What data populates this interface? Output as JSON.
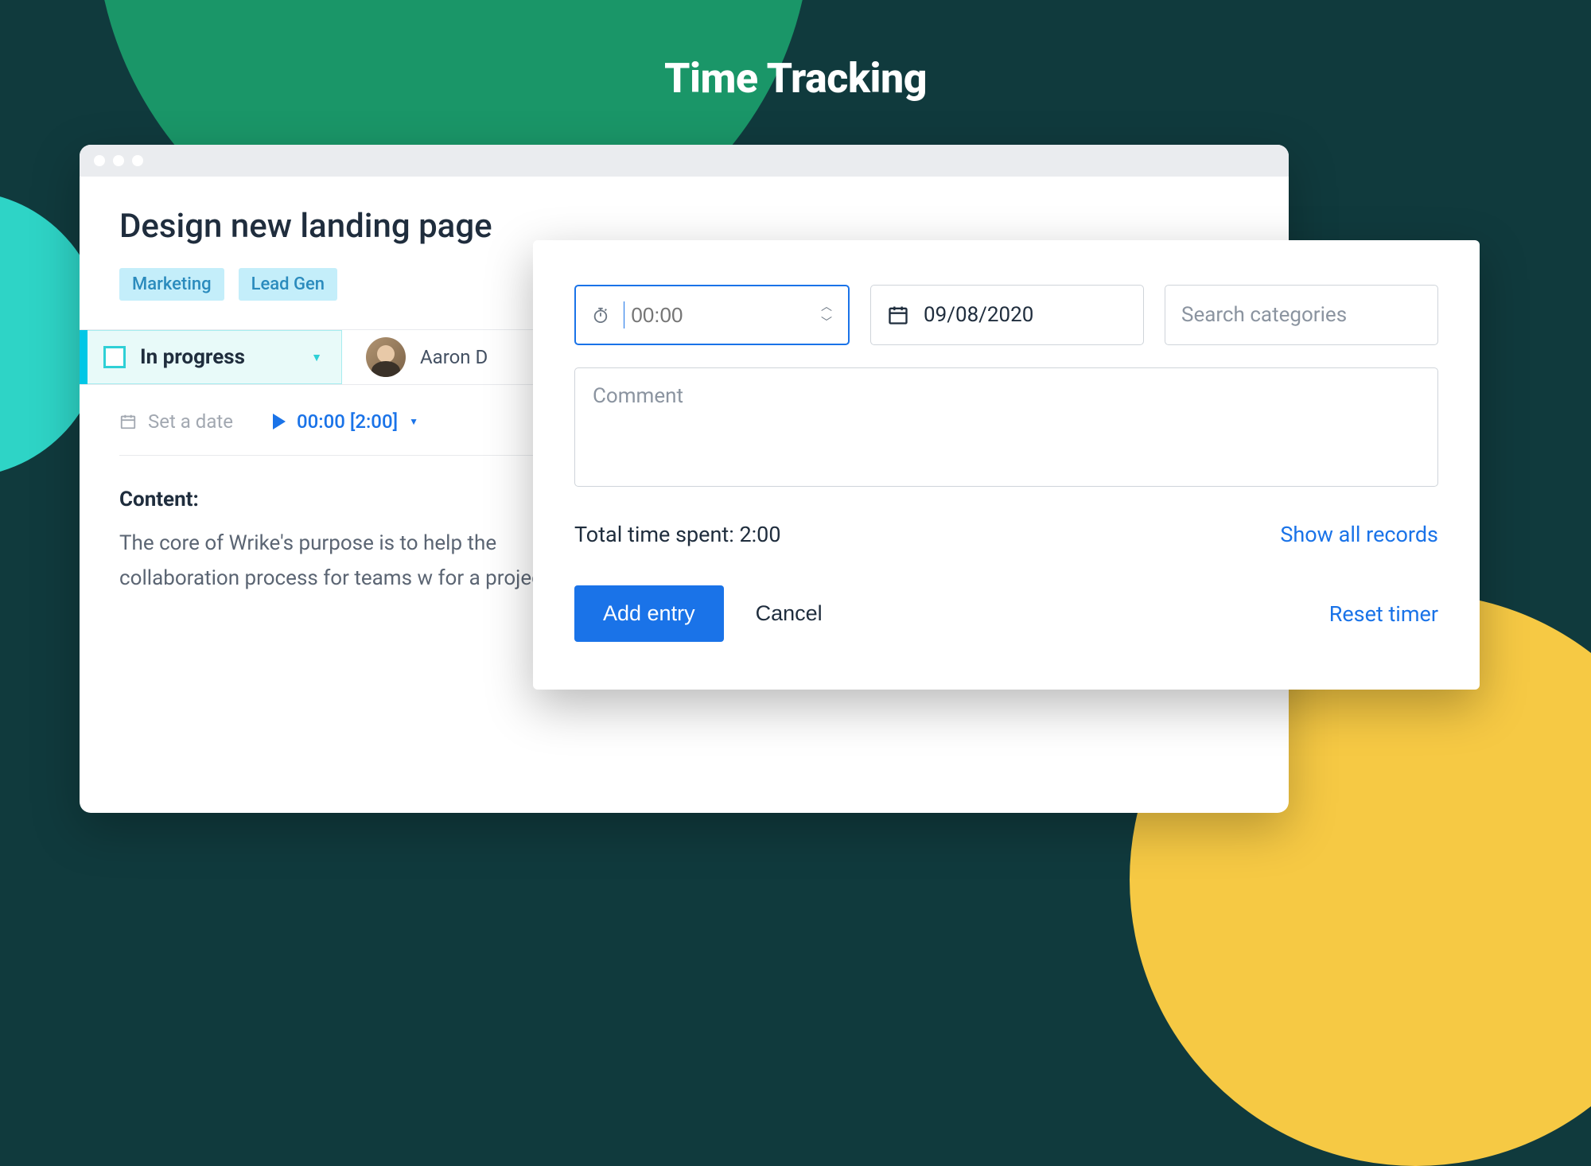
{
  "page_title": "Time Tracking",
  "task": {
    "title": "Design new landing page",
    "tags": [
      "Marketing",
      "Lead Gen"
    ],
    "status": "In progress",
    "assignee_name": "Aaron D",
    "date_placeholder": "Set a date",
    "timer_value": "00:00 [2:00]",
    "content_heading": "Content:",
    "content_body": "The core of Wrike's purpose is to help the collaboration process for teams w for a project."
  },
  "popup": {
    "time_placeholder": "00:00",
    "date_value": "09/08/2020",
    "search_placeholder": "Search categories",
    "comment_placeholder": "Comment",
    "total_label": "Total time spent: 2:00",
    "show_all": "Show all records",
    "add_entry": "Add entry",
    "cancel": "Cancel",
    "reset": "Reset timer"
  }
}
